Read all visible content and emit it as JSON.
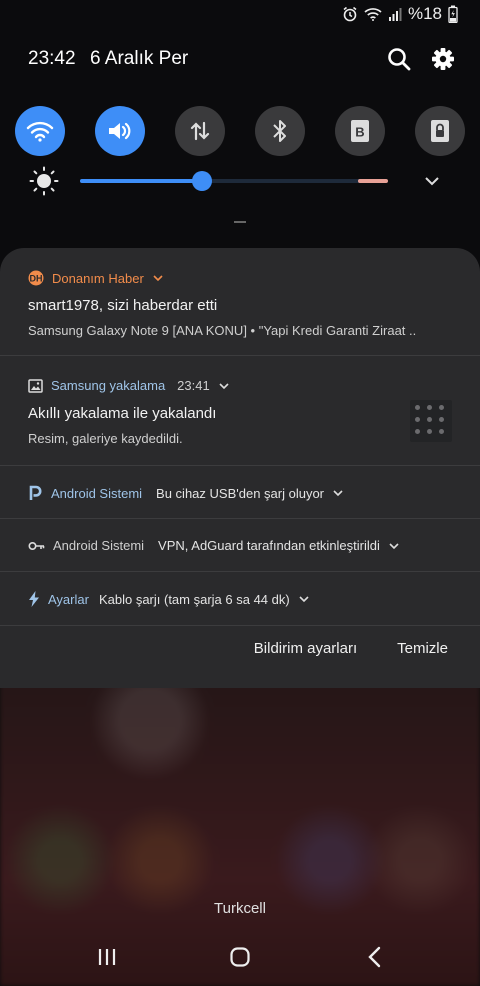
{
  "status": {
    "battery_text": "%18",
    "icons": [
      "alarm-icon",
      "wifi-icon",
      "cell-signal-icon",
      "battery-charging-icon"
    ]
  },
  "header": {
    "time": "23:42",
    "date": "6 Aralık Per",
    "icons": [
      "search-icon",
      "gear-icon"
    ]
  },
  "quick_toggles": [
    {
      "name": "wifi",
      "icon": "wifi-icon",
      "active": true
    },
    {
      "name": "sound",
      "icon": "volume-icon",
      "active": true
    },
    {
      "name": "mobile-data",
      "icon": "data-arrows-icon",
      "active": false
    },
    {
      "name": "bluetooth",
      "icon": "bluetooth-icon",
      "active": false
    },
    {
      "name": "blue-light",
      "icon": "blue-light-icon",
      "active": false
    },
    {
      "name": "lock",
      "icon": "lock-icon",
      "active": false
    }
  ],
  "brightness": {
    "level": 0.4
  },
  "notifications": [
    {
      "app": "Donanım Haber",
      "app_color": "#f28c4b",
      "title": "smart1978, sizi haberdar etti",
      "text": "Samsung Galaxy Note 9 [ANA KONU]  •  \"Yapi Kredi Garanti Ziraat .."
    },
    {
      "app": "Samsung yakalama",
      "time": "23:41",
      "title": "Akıllı yakalama ile yakalandı",
      "text": "Resim, galeriye kaydedildi."
    },
    {
      "app": "Android Sistemi",
      "text": "Bu cihaz USB'den şarj oluyor"
    },
    {
      "app": "Android Sistemi",
      "text": "VPN, AdGuard tarafından etkinleştirildi"
    },
    {
      "app": "Ayarlar",
      "text": "Kablo şarjı (tam şarja 6 sa 44 dk)"
    }
  ],
  "actions": {
    "settings_label": "Bildirim ayarları",
    "clear_label": "Temizle"
  },
  "carrier": "Turkcell",
  "colors": {
    "accent": "#3e8ef7",
    "panel": "#2a2a2c",
    "app_name": "#9fc4e8"
  }
}
